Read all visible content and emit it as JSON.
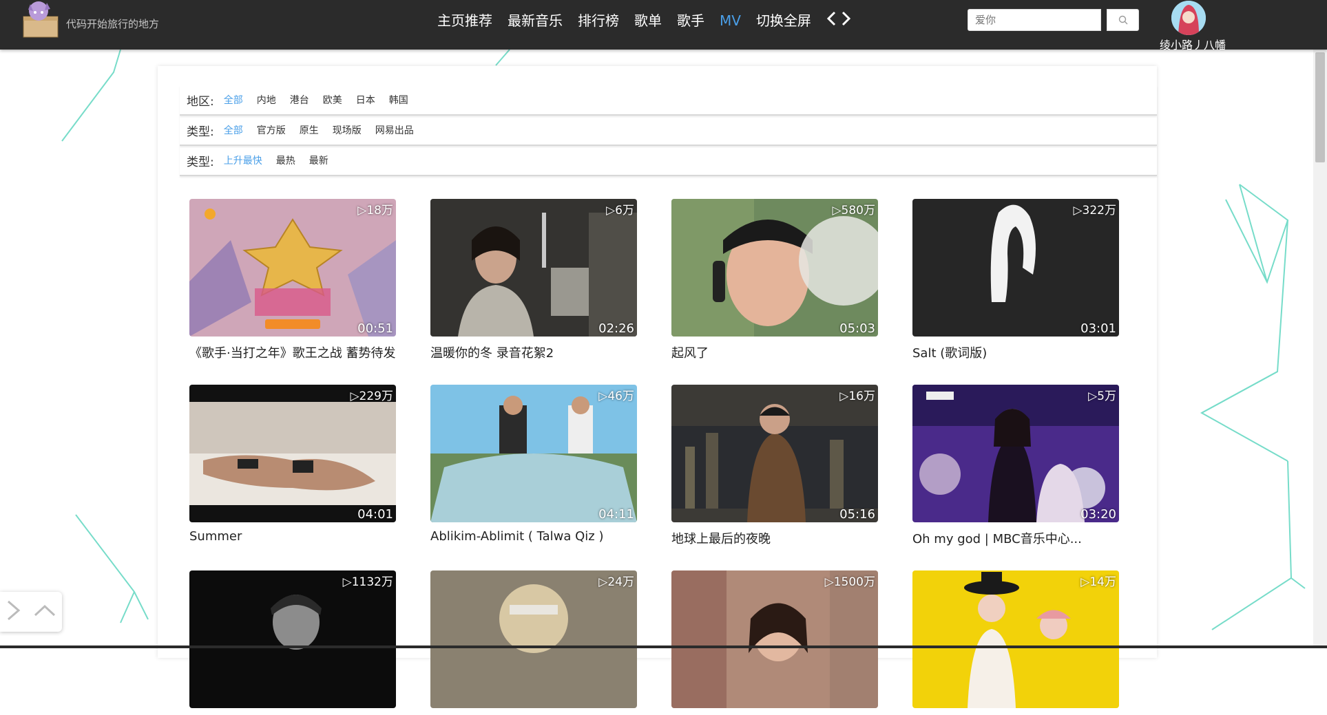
{
  "header": {
    "logo_text": "代码开始旅行的地方",
    "nav": [
      {
        "label": "主页推荐",
        "active": false
      },
      {
        "label": "最新音乐",
        "active": false
      },
      {
        "label": "排行榜",
        "active": false
      },
      {
        "label": "歌单",
        "active": false
      },
      {
        "label": "歌手",
        "active": false
      },
      {
        "label": "MV",
        "active": true
      },
      {
        "label": "切换全屏",
        "active": false
      }
    ],
    "search_value": "",
    "search_placeholder": "爱你",
    "username": "绫小路丿八幡"
  },
  "filters": {
    "area": {
      "label": "地区:",
      "options": [
        "全部",
        "内地",
        "港台",
        "欧美",
        "日本",
        "韩国"
      ],
      "active": "全部"
    },
    "type": {
      "label": "类型:",
      "options": [
        "全部",
        "官方版",
        "原生",
        "现场版",
        "网易出品"
      ],
      "active": "全部"
    },
    "sort": {
      "label": "类型:",
      "options": [
        "上升最快",
        "最热",
        "最新"
      ],
      "active": "上升最快"
    }
  },
  "mvs": [
    {
      "title": "《歌手·当打之年》歌王之战 蓄势待发",
      "plays": "18万",
      "duration": "00:51"
    },
    {
      "title": "温暖你的冬 录音花絮2",
      "plays": "6万",
      "duration": "02:26"
    },
    {
      "title": "起风了",
      "plays": "580万",
      "duration": "05:03"
    },
    {
      "title": "Salt (歌词版)",
      "plays": "322万",
      "duration": "03:01"
    },
    {
      "title": "Summer",
      "plays": "229万",
      "duration": "04:01"
    },
    {
      "title": "Ablikim-Ablimit ( Talwa Qiz )",
      "plays": "46万",
      "duration": "04:11"
    },
    {
      "title": "地球上最后的夜晚",
      "plays": "16万",
      "duration": "05:16"
    },
    {
      "title": "Oh my god | MBC音乐中心...",
      "plays": "5万",
      "duration": "03:20"
    },
    {
      "title": "",
      "plays": "1132万",
      "duration": ""
    },
    {
      "title": "",
      "plays": "24万",
      "duration": ""
    },
    {
      "title": "",
      "plays": "1500万",
      "duration": ""
    },
    {
      "title": "",
      "plays": "14万",
      "duration": ""
    }
  ],
  "colors": {
    "accent": "#4a9fe8",
    "header_bg": "#2b2b2b",
    "bg_line": "#5fd6c0"
  }
}
